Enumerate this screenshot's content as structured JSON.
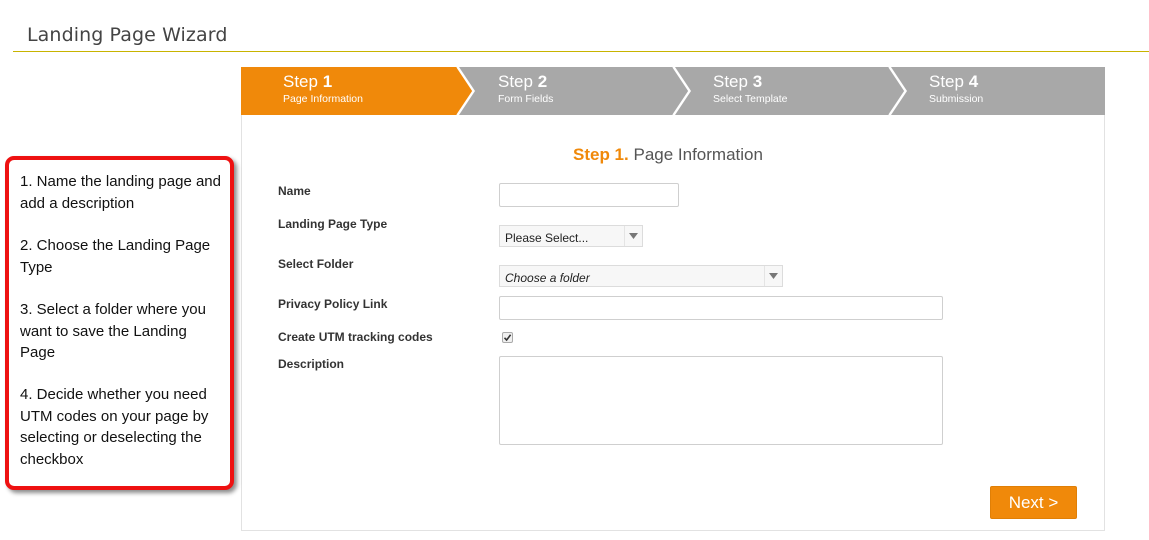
{
  "header": {
    "title": "Landing Page Wizard"
  },
  "steps": [
    {
      "word": "Step",
      "number": "1",
      "subtitle": "Page Information",
      "active": true
    },
    {
      "word": "Step",
      "number": "2",
      "subtitle": "Form Fields",
      "active": false
    },
    {
      "word": "Step",
      "number": "3",
      "subtitle": "Select Template",
      "active": false
    },
    {
      "word": "Step",
      "number": "4",
      "subtitle": "Submission",
      "active": false
    }
  ],
  "form": {
    "heading_step": "Step 1.",
    "heading_text": "Page Information",
    "name_label": "Name",
    "name_value": "",
    "type_label": "Landing Page Type",
    "type_value": "Please Select...",
    "folder_label": "Select Folder",
    "folder_value": "Choose a folder",
    "privacy_label": "Privacy Policy Link",
    "privacy_value": "",
    "utm_label": "Create UTM tracking codes",
    "utm_checked": true,
    "description_label": "Description",
    "description_value": ""
  },
  "actions": {
    "next_label": "Next >"
  },
  "callout": {
    "items": [
      "1. Name the landing page and add a description",
      "2. Choose the Landing Page Type",
      "3. Select a folder where you want to save the Landing Page",
      "4. Decide whether you need UTM codes on your page by selecting or deselecting the checkbox"
    ]
  },
  "colors": {
    "accent": "#f0890a",
    "inactive_step": "#a8a8a8",
    "callout_border": "#ee1111",
    "header_rule": "#c8b400"
  },
  "icons": {
    "select_arrow": "triangle-down-icon",
    "checkbox": "checkmark-icon"
  }
}
